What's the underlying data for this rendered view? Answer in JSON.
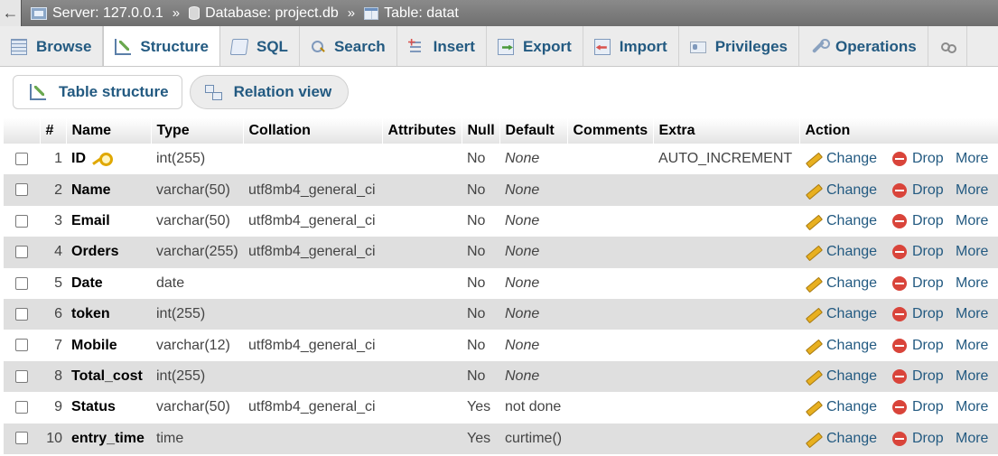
{
  "breadcrumb": {
    "back_glyph": "←",
    "server": "Server: 127.0.0.1",
    "database": "Database: project.db",
    "table": "Table: datat",
    "separator": "»"
  },
  "tabs": [
    {
      "label": "Browse",
      "icon": "browse-icon"
    },
    {
      "label": "Structure",
      "icon": "structure-icon",
      "active": true
    },
    {
      "label": "SQL",
      "icon": "sql-icon"
    },
    {
      "label": "Search",
      "icon": "search-icon"
    },
    {
      "label": "Insert",
      "icon": "insert-icon"
    },
    {
      "label": "Export",
      "icon": "export-icon"
    },
    {
      "label": "Import",
      "icon": "import-icon"
    },
    {
      "label": "Privileges",
      "icon": "privileges-icon"
    },
    {
      "label": "Operations",
      "icon": "operations-icon"
    }
  ],
  "subtabs": {
    "table_structure": "Table structure",
    "relation_view": "Relation view"
  },
  "columns": {
    "num": "#",
    "name": "Name",
    "type": "Type",
    "collation": "Collation",
    "attributes": "Attributes",
    "null": "Null",
    "default": "Default",
    "comments": "Comments",
    "extra": "Extra",
    "action": "Action"
  },
  "actions": {
    "change": "Change",
    "drop": "Drop",
    "more": "More"
  },
  "rows": [
    {
      "num": "1",
      "name": "ID",
      "type": "int(255)",
      "collation": "",
      "attributes": "",
      "null": "No",
      "default": "None",
      "comments": "",
      "extra": "AUTO_INCREMENT",
      "primary_key": true
    },
    {
      "num": "2",
      "name": "Name",
      "type": "varchar(50)",
      "collation": "utf8mb4_general_ci",
      "attributes": "",
      "null": "No",
      "default": "None",
      "comments": "",
      "extra": ""
    },
    {
      "num": "3",
      "name": "Email",
      "type": "varchar(50)",
      "collation": "utf8mb4_general_ci",
      "attributes": "",
      "null": "No",
      "default": "None",
      "comments": "",
      "extra": ""
    },
    {
      "num": "4",
      "name": "Orders",
      "type": "varchar(255)",
      "collation": "utf8mb4_general_ci",
      "attributes": "",
      "null": "No",
      "default": "None",
      "comments": "",
      "extra": ""
    },
    {
      "num": "5",
      "name": "Date",
      "type": "date",
      "collation": "",
      "attributes": "",
      "null": "No",
      "default": "None",
      "comments": "",
      "extra": ""
    },
    {
      "num": "6",
      "name": "token",
      "type": "int(255)",
      "collation": "",
      "attributes": "",
      "null": "No",
      "default": "None",
      "comments": "",
      "extra": ""
    },
    {
      "num": "7",
      "name": "Mobile",
      "type": "varchar(12)",
      "collation": "utf8mb4_general_ci",
      "attributes": "",
      "null": "No",
      "default": "None",
      "comments": "",
      "extra": ""
    },
    {
      "num": "8",
      "name": "Total_cost",
      "type": "int(255)",
      "collation": "",
      "attributes": "",
      "null": "No",
      "default": "None",
      "comments": "",
      "extra": ""
    },
    {
      "num": "9",
      "name": "Status",
      "type": "varchar(50)",
      "collation": "utf8mb4_general_ci",
      "attributes": "",
      "null": "Yes",
      "default": "not done",
      "comments": "",
      "extra": ""
    },
    {
      "num": "10",
      "name": "entry_time",
      "type": "time",
      "collation": "",
      "attributes": "",
      "null": "Yes",
      "default": "curtime()",
      "comments": "",
      "extra": ""
    }
  ]
}
